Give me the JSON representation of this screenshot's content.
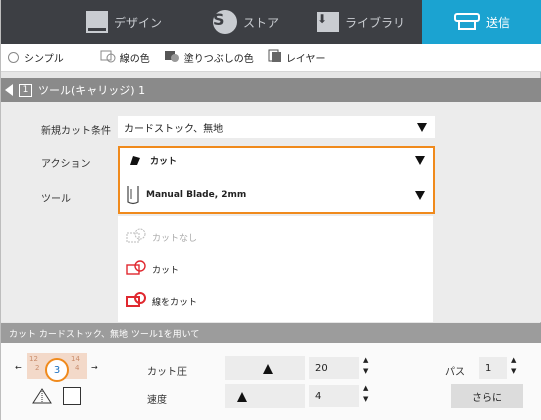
{
  "tabs": {
    "design": "デザイン",
    "store": "ストア",
    "library": "ライブラリ",
    "send": "送信"
  },
  "mode_bar": {
    "simple": "シンプル",
    "line_color": "線の色",
    "fill_color": "塗りつぶしの色",
    "layer": "レイヤー"
  },
  "tool_header": {
    "index": "1",
    "title": "ツール(キャリッジ) 1"
  },
  "settings": {
    "cut_condition_label": "新規カット条件",
    "cut_condition_value": "カードストック、無地",
    "action_label": "アクション",
    "action_value": "カット",
    "tool_label": "ツール",
    "tool_value": "Manual Blade, 2mm"
  },
  "dropdown": {
    "items": [
      "カットなし",
      "カット",
      "線をカット"
    ]
  },
  "cut_section": {
    "header": "カット カードストック、無地 ツール1を用いて",
    "pressure_label": "カット圧",
    "pressure_value": "20",
    "speed_label": "速度",
    "speed_value": "4",
    "pass_label": "パス",
    "pass_value": "1",
    "more_button": "さらに",
    "blade_depth": "3",
    "blade_scale_left": "12",
    "blade_scale_left2": "2",
    "blade_scale_right": "14",
    "blade_scale_right2": "4"
  },
  "levels": {
    "pressure_fraction": 0.4,
    "speed_fraction": 0.08
  },
  "colors": {
    "topbar": "#3d3f44",
    "send_tab": "#1ba3d1",
    "highlight": "#f08a1c",
    "cut_red": "#e0282f"
  }
}
